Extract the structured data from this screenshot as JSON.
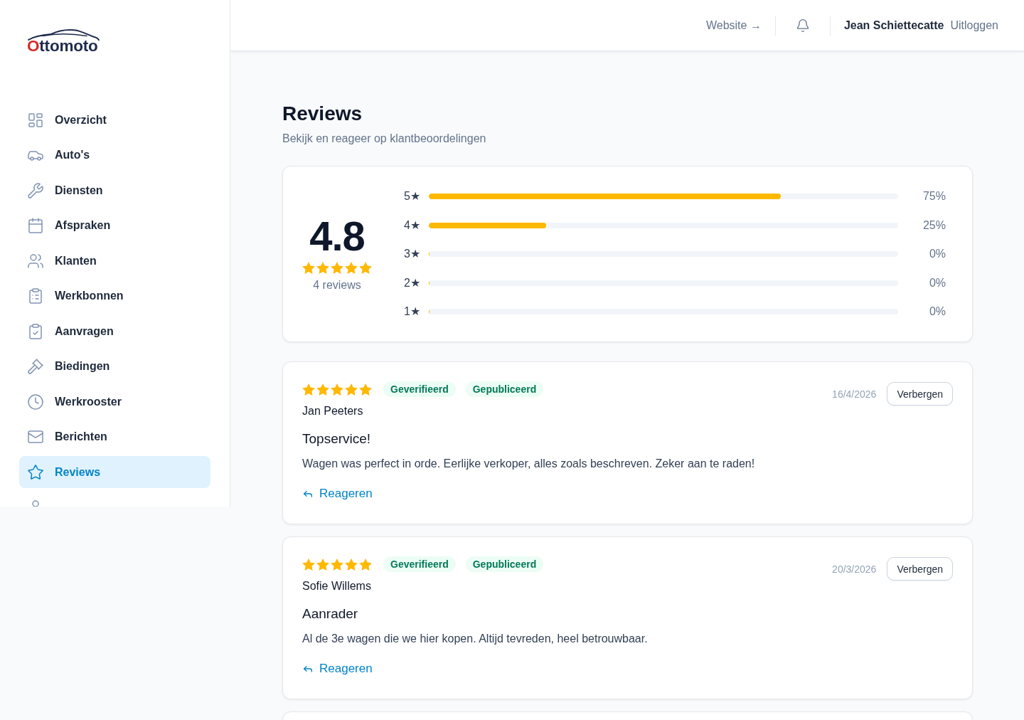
{
  "logo": {
    "text": "Ottomoto"
  },
  "header": {
    "website_link": "Website →",
    "user_name": "Jean Schiettecatte",
    "logout": "Uitloggen"
  },
  "sidebar": {
    "items": [
      {
        "label": "Overzicht",
        "selected": false
      },
      {
        "label": "Auto's",
        "selected": false
      },
      {
        "label": "Diensten",
        "selected": false
      },
      {
        "label": "Afspraken",
        "selected": false
      },
      {
        "label": "Klanten",
        "selected": false
      },
      {
        "label": "Werkbonnen",
        "selected": false
      },
      {
        "label": "Aanvragen",
        "selected": false
      },
      {
        "label": "Biedingen",
        "selected": false
      },
      {
        "label": "Werkrooster",
        "selected": false
      },
      {
        "label": "Berichten",
        "selected": false
      },
      {
        "label": "Reviews",
        "selected": true
      },
      {
        "selected": false
      }
    ]
  },
  "page": {
    "title": "Reviews",
    "subtitle": "Bekijk en reageer op klantbeoordelingen"
  },
  "summary": {
    "average": "4.8",
    "stars": 5,
    "count": "4 reviews",
    "distribution": [
      {
        "label": "5★",
        "level": 0.75,
        "reading": "75%"
      },
      {
        "label": "4★",
        "level": 0.25,
        "reading": "25%"
      },
      {
        "label": "3★",
        "level": 0,
        "reading": "0%"
      },
      {
        "label": "2★",
        "level": 0,
        "reading": "0%"
      },
      {
        "label": "1★",
        "level": 0,
        "reading": "0%"
      }
    ]
  },
  "reviews": [
    {
      "stars": 5,
      "badges": [
        "Geverifieerd",
        "Gepubliceerd"
      ],
      "author": "Jan Peeters",
      "date": "16/4/2026",
      "action": "Verbergen",
      "title": "Topservice!",
      "text": "Wagen was perfect in orde. Eerlijke verkoper, alles zoals beschreven. Zeker aan te raden!",
      "reply": "Reageren"
    },
    {
      "stars": 5,
      "badges": [
        "Geverifieerd",
        "Gepubliceerd"
      ],
      "author": "Sofie Willems",
      "date": "20/3/2026",
      "action": "Verbergen",
      "title": "Aanrader",
      "text": "Al de 3e wagen die we hier kopen. Altijd tevreden, heel betrouwbaar.",
      "reply": "Reageren"
    }
  ]
}
